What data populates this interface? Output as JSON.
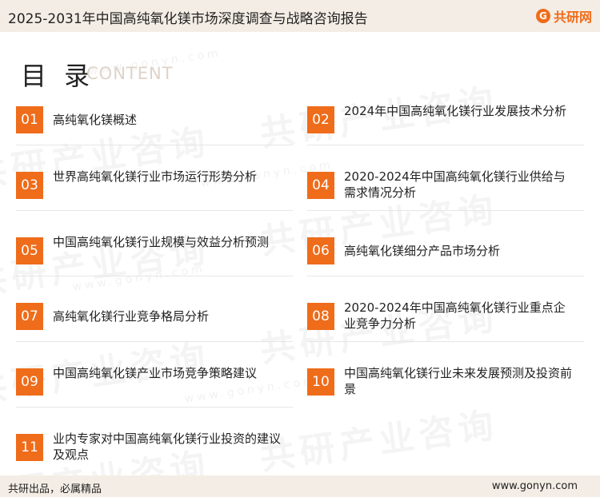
{
  "header": {
    "title": "2025-2031年中国高纯氧化镁市场深度调查与战略咨询报告",
    "brand_name": "共研网",
    "brand_logo_letter": "G"
  },
  "toc": {
    "heading": "目 录",
    "subheading": "CONTENT",
    "items": [
      {
        "num": "01",
        "title": "高纯氧化镁概述"
      },
      {
        "num": "02",
        "title": "2024年中国高纯氧化镁行业发展技术分析"
      },
      {
        "num": "03",
        "title": "世界高纯氧化镁行业市场运行形势分析"
      },
      {
        "num": "04",
        "title": "2020-2024年中国高纯氧化镁行业供给与需求情况分析"
      },
      {
        "num": "05",
        "title": "中国高纯氧化镁行业规模与效益分析预测"
      },
      {
        "num": "06",
        "title": "高纯氧化镁细分产品市场分析"
      },
      {
        "num": "07",
        "title": "高纯氧化镁行业竞争格局分析"
      },
      {
        "num": "08",
        "title": "2020-2024年中国高纯氧化镁行业重点企业竞争力分析"
      },
      {
        "num": "09",
        "title": "中国高纯氧化镁产业市场竞争策略建议"
      },
      {
        "num": "10",
        "title": "中国高纯氧化镁行业未来发展预测及投资前景"
      },
      {
        "num": "11",
        "title": "业内专家对中国高纯氧化镁行业投资的建议及观点"
      }
    ]
  },
  "watermark": {
    "text": "共研产业咨询",
    "url": "www.gonyn.com"
  },
  "footer": {
    "slogan": "共研出品，必属精品",
    "website": "www.gonyn.com"
  },
  "colors": {
    "accent": "#ef6c1a",
    "band": "#f4ede5"
  }
}
